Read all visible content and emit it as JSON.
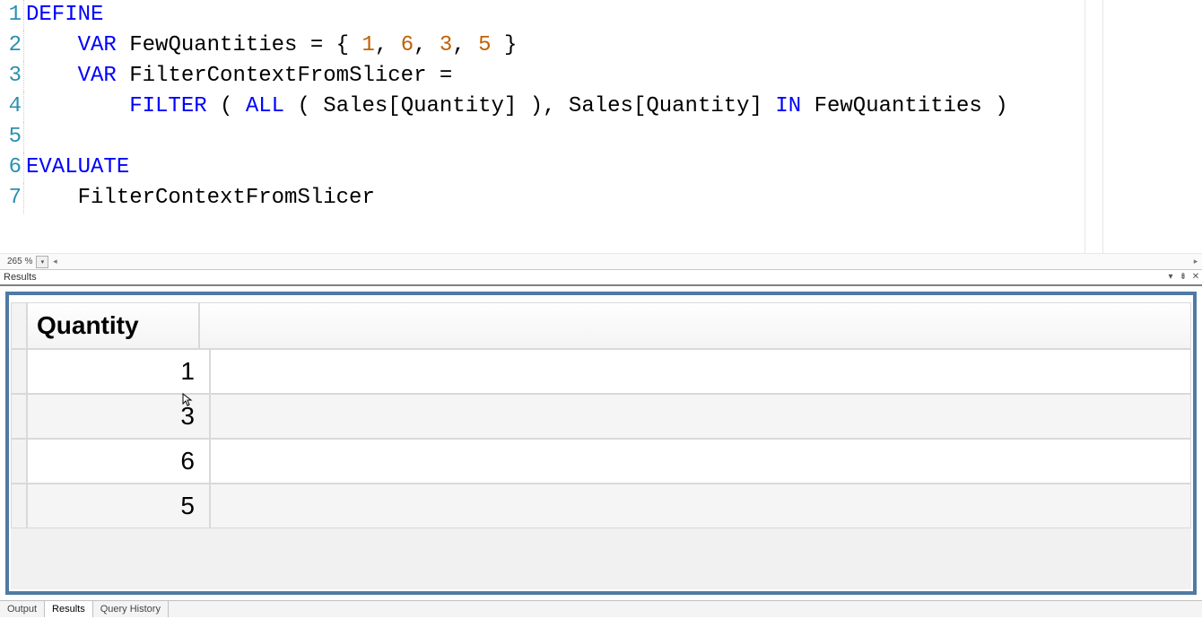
{
  "editor": {
    "zoom": "265 %",
    "lines": [
      {
        "n": "1",
        "tokens": [
          {
            "t": "DEFINE",
            "c": "tok-kw"
          }
        ]
      },
      {
        "n": "2",
        "tokens": [
          {
            "t": "    ",
            "c": "tok-txt"
          },
          {
            "t": "VAR",
            "c": "tok-kw"
          },
          {
            "t": " FewQuantities = { ",
            "c": "tok-txt"
          },
          {
            "t": "1",
            "c": "tok-num"
          },
          {
            "t": ", ",
            "c": "tok-txt"
          },
          {
            "t": "6",
            "c": "tok-num"
          },
          {
            "t": ", ",
            "c": "tok-txt"
          },
          {
            "t": "3",
            "c": "tok-num"
          },
          {
            "t": ", ",
            "c": "tok-txt"
          },
          {
            "t": "5",
            "c": "tok-num"
          },
          {
            "t": " }",
            "c": "tok-txt"
          }
        ]
      },
      {
        "n": "3",
        "tokens": [
          {
            "t": "    ",
            "c": "tok-txt"
          },
          {
            "t": "VAR",
            "c": "tok-kw"
          },
          {
            "t": " FilterContextFromSlicer =",
            "c": "tok-txt"
          }
        ]
      },
      {
        "n": "4",
        "tokens": [
          {
            "t": "        ",
            "c": "tok-txt"
          },
          {
            "t": "FILTER",
            "c": "tok-fn"
          },
          {
            "t": " ( ",
            "c": "tok-txt"
          },
          {
            "t": "ALL",
            "c": "tok-fn"
          },
          {
            "t": " ( Sales[Quantity] ), Sales[Quantity] ",
            "c": "tok-txt"
          },
          {
            "t": "IN",
            "c": "tok-fn"
          },
          {
            "t": " FewQuantities )",
            "c": "tok-txt"
          }
        ]
      },
      {
        "n": "5",
        "tokens": [
          {
            "t": "",
            "c": "tok-txt"
          }
        ]
      },
      {
        "n": "6",
        "tokens": [
          {
            "t": "EVALUATE",
            "c": "tok-kw"
          }
        ]
      },
      {
        "n": "7",
        "tokens": [
          {
            "t": "    FilterContextFromSlicer",
            "c": "tok-txt"
          }
        ]
      }
    ]
  },
  "results_panel": {
    "title": "Results",
    "column_header": "Quantity",
    "rows": [
      "1",
      "3",
      "6",
      "5"
    ]
  },
  "tabs": {
    "output": "Output",
    "results": "Results",
    "history": "Query History",
    "active": "results"
  }
}
